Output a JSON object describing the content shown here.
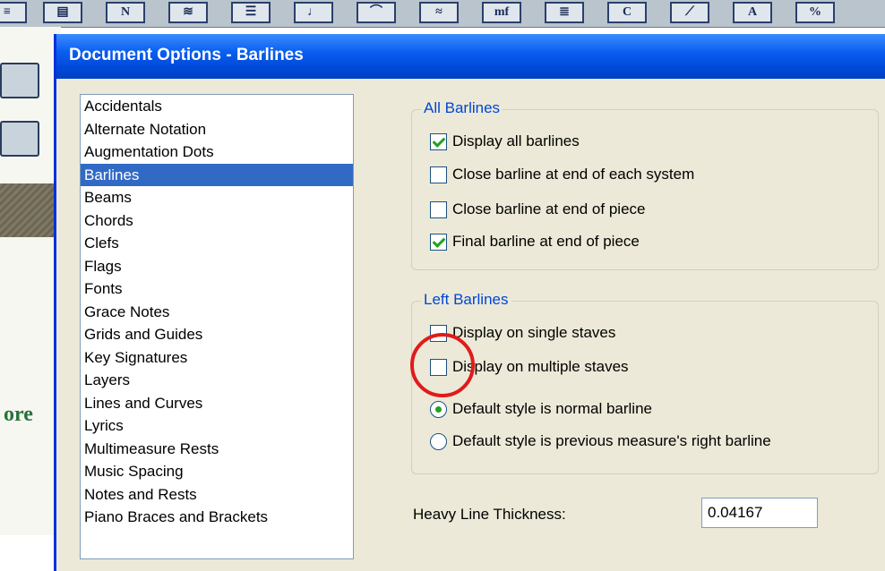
{
  "app_toolbar": {
    "buttons": [
      {
        "icon": "list-tool-icon",
        "label": "≡"
      },
      {
        "icon": "page-layout-icon",
        "label": "▤"
      },
      {
        "icon": "text-tool-icon",
        "label": "N"
      },
      {
        "icon": "expression-tool-icon",
        "label": "≋"
      },
      {
        "icon": "staff-tool-icon",
        "label": "☰"
      },
      {
        "icon": "note-tool-icon",
        "label": "♩"
      },
      {
        "icon": "curve-tool-icon",
        "label": "⌒"
      },
      {
        "icon": "articulation-tool-icon",
        "label": "≈"
      },
      {
        "icon": "mf-expression-icon",
        "label": "mf"
      },
      {
        "icon": "measure-tool-icon",
        "label": "≣"
      },
      {
        "icon": "chord-tool-icon",
        "label": "C"
      },
      {
        "icon": "smart-shape-icon",
        "label": "⟋"
      },
      {
        "icon": "lyrics-tool-icon",
        "label": "A"
      },
      {
        "icon": "percentage-tool-icon",
        "label": "%"
      }
    ],
    "left_partial_text": "ore"
  },
  "dialog": {
    "title": "Document Options - Barlines",
    "categories": [
      "Accidentals",
      "Alternate Notation",
      "Augmentation Dots",
      "Barlines",
      "Beams",
      "Chords",
      "Clefs",
      "Flags",
      "Fonts",
      "Grace Notes",
      "Grids and Guides",
      "Key Signatures",
      "Layers",
      "Lines and Curves",
      "Lyrics",
      "Multimeasure Rests",
      "Music Spacing",
      "Notes and Rests",
      "Piano Braces and Brackets"
    ],
    "selected_category": "Barlines",
    "all_barlines": {
      "label": "All Barlines",
      "options": [
        {
          "label": "Display all barlines",
          "checked": true
        },
        {
          "label": "Close barline at end of each system",
          "checked": false
        },
        {
          "label": "Close barline at end of piece",
          "checked": false
        },
        {
          "label": "Final barline at end of piece",
          "checked": true
        }
      ]
    },
    "left_barlines": {
      "label": "Left Barlines",
      "checkboxes": [
        {
          "label": "Display on single staves",
          "checked": false
        },
        {
          "label": "Display on multiple staves",
          "checked": false
        }
      ],
      "radios": [
        {
          "label": "Default style is normal barline",
          "selected": true
        },
        {
          "label": "Default style is previous measure's right barline",
          "selected": false
        }
      ]
    },
    "heavy_line_thickness": {
      "label": "Heavy Line Thickness:",
      "value": "0.04167"
    }
  },
  "colors": {
    "title_bar": "#0a5ff0",
    "selection": "#316ac5",
    "dialog_bg": "#ece9d8",
    "group_label": "#0046d5",
    "check_mark": "#21a121",
    "highlight_circle": "#e01b1b"
  }
}
